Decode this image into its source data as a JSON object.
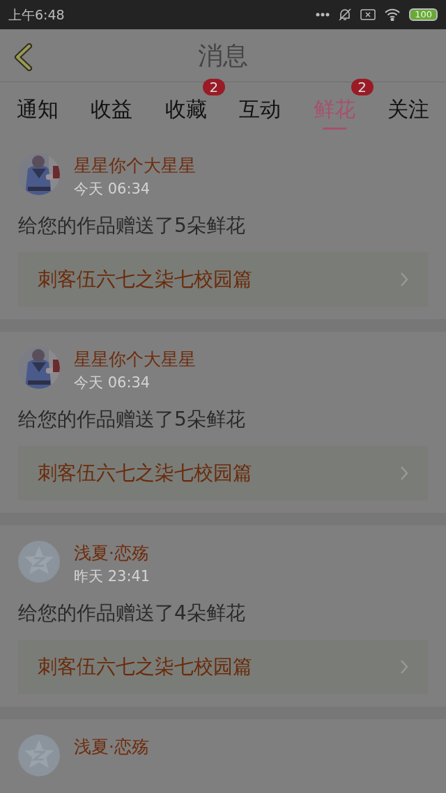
{
  "status_bar": {
    "time": "上午6:48",
    "battery": "100"
  },
  "header": {
    "title": "消息"
  },
  "tabs": [
    {
      "label": "通知",
      "selected": false
    },
    {
      "label": "收益",
      "selected": false
    },
    {
      "label": "收藏",
      "selected": false,
      "badge": "2"
    },
    {
      "label": "互动",
      "selected": false
    },
    {
      "label": "鲜花",
      "selected": true,
      "badge": "2"
    },
    {
      "label": "关注",
      "selected": false
    }
  ],
  "messages": [
    {
      "name": "星星你个大星星",
      "time": "今天 06:34",
      "text": "给您的作品赠送了5朵鲜花",
      "work": "刺客伍六七之柒七校园篇"
    },
    {
      "name": "星星你个大星星",
      "time": "今天 06:34",
      "text": "给您的作品赠送了5朵鲜花",
      "work": "刺客伍六七之柒七校园篇"
    },
    {
      "avatar": {
        "kind": "default"
      },
      "name": "浅夏·恋殇",
      "time": "昨天 23:41",
      "text": "给您的作品赠送了4朵鲜花",
      "work": "刺客伍六七之柒七校园篇"
    },
    {
      "avatar": {
        "kind": "default"
      },
      "name": "浅夏·恋殇"
    }
  ]
}
